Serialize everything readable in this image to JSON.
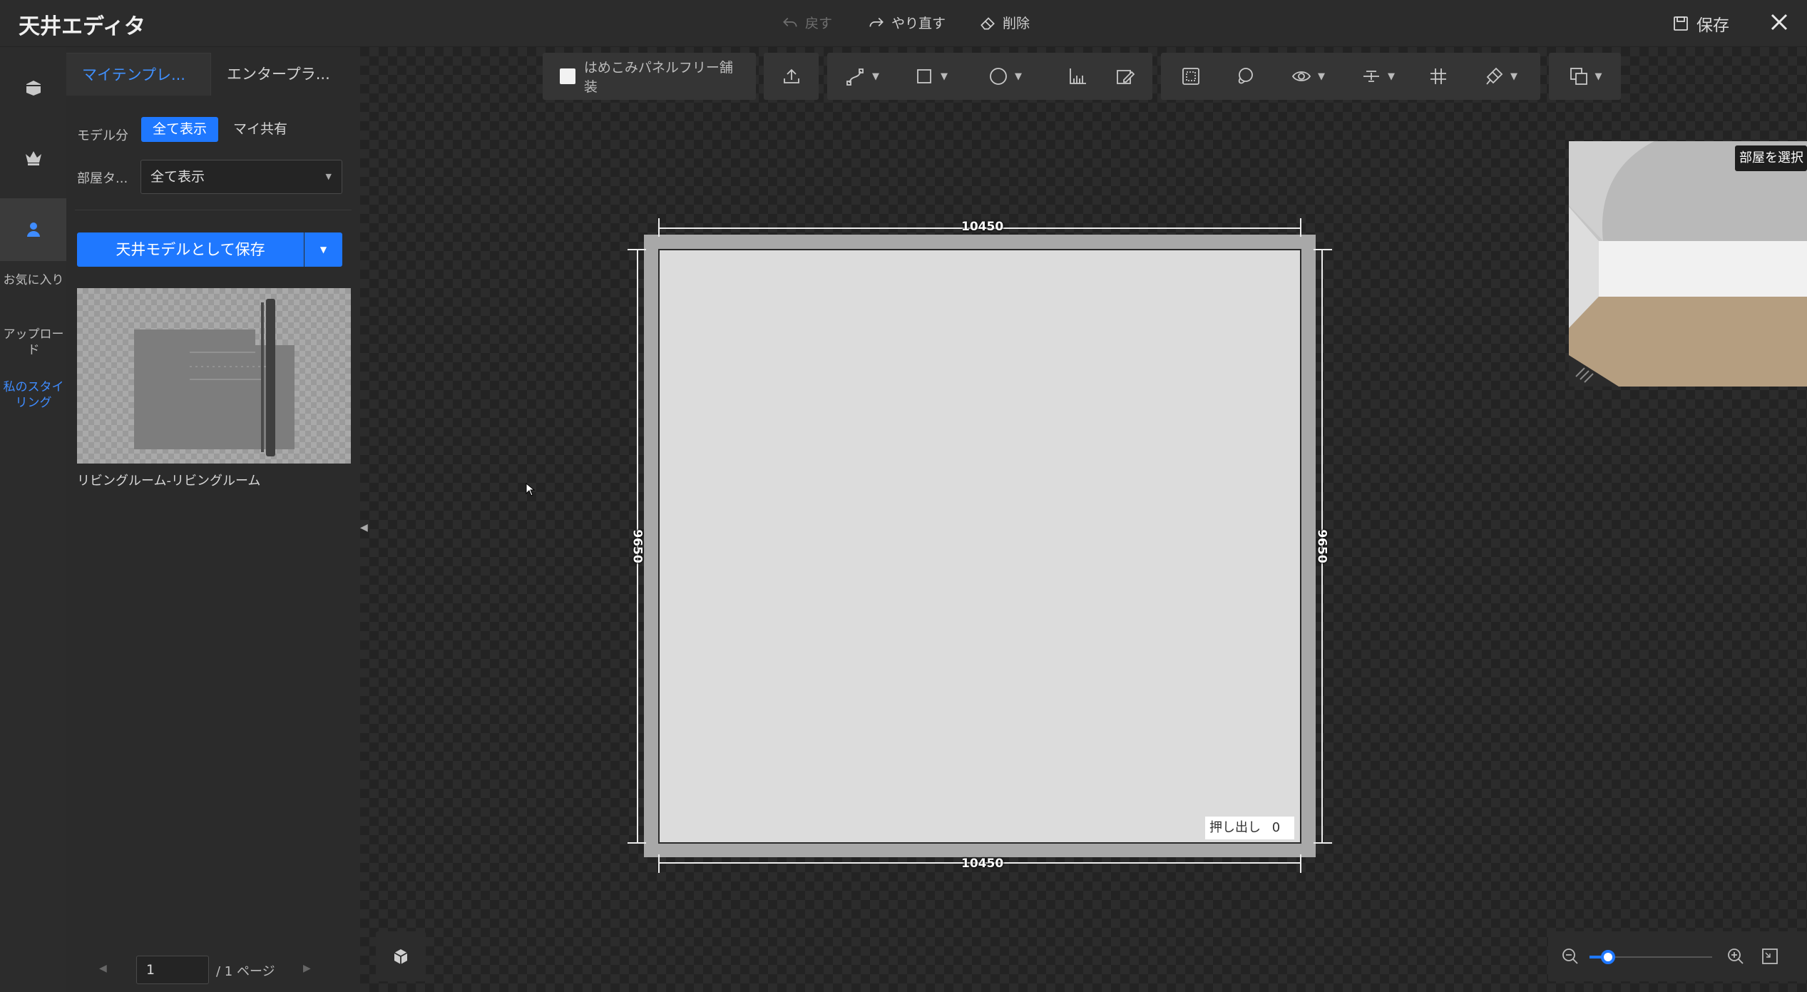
{
  "header": {
    "title": "天井エディタ",
    "undo_label": "戻す",
    "redo_label": "やり直す",
    "delete_label": "削除",
    "save_label": "保存"
  },
  "sidebar_icons": {
    "items": [
      {
        "icon": "box-icon"
      },
      {
        "icon": "crown-icon"
      },
      {
        "icon": "user-icon",
        "active": true
      }
    ],
    "text_items": [
      "お気に入り",
      "アップロード",
      "私のスタイリング"
    ]
  },
  "panel": {
    "tabs": [
      "マイテンプレ...",
      "エンタープラ..."
    ],
    "model_filter_label": "モデル分",
    "model_filter_options": [
      "全て表示",
      "マイ共有"
    ],
    "room_type_label": "部屋タ...",
    "room_type_value": "全て表示",
    "save_button_label": "天井モデルとして保存",
    "template_caption": "リビングルーム-リビングルーム",
    "pager": {
      "current": "1",
      "total_label": "/ 1 ページ"
    }
  },
  "toolbar": {
    "checkbox_label": "はめこみパネルフリー舗装"
  },
  "canvas": {
    "dim_top": "10450",
    "dim_bottom": "10450",
    "dim_left": "9650",
    "dim_right": "9650",
    "extrude_label": "押し出し",
    "extrude_value": "0"
  },
  "preview": {
    "select_room_label": "部屋を選択"
  },
  "zoom": {
    "level_fraction": 0.15
  },
  "colors": {
    "accent": "#1f78ff",
    "active_text": "#4090ff"
  }
}
